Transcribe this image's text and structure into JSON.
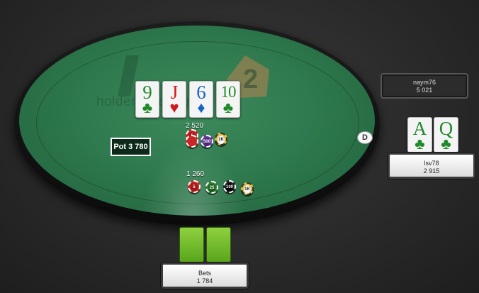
{
  "board": {
    "cards": [
      {
        "rank": "9",
        "suit": "♣",
        "color": "#1f8a2a"
      },
      {
        "rank": "J",
        "suit": "♥",
        "color": "#d11a1a"
      },
      {
        "rank": "6",
        "suit": "♦",
        "color": "#1565c0"
      },
      {
        "rank": "10",
        "suit": "♣",
        "color": "#1f8a2a"
      }
    ]
  },
  "logo": {
    "text": "holdem manager",
    "number": "2"
  },
  "pot": {
    "label": "Pot 3 780"
  },
  "bets": {
    "top": {
      "amount": "2 520",
      "chips": [
        "5",
        "500",
        "1K"
      ]
    },
    "bottom": {
      "amount": "1 260",
      "chips": [
        "5",
        "25",
        "100",
        "1K"
      ]
    }
  },
  "dealer_button": {
    "label": "D"
  },
  "players": {
    "top_right": {
      "name": "naym76",
      "stack": "5 021"
    },
    "right": {
      "name": "lsv78",
      "stack": "2 915",
      "cards": [
        {
          "rank": "A",
          "suit": "♣",
          "color": "#1f8a2a"
        },
        {
          "rank": "Q",
          "suit": "♣",
          "color": "#1f8a2a"
        }
      ]
    },
    "hero": {
      "name": "Bets",
      "stack": "1 784"
    }
  }
}
